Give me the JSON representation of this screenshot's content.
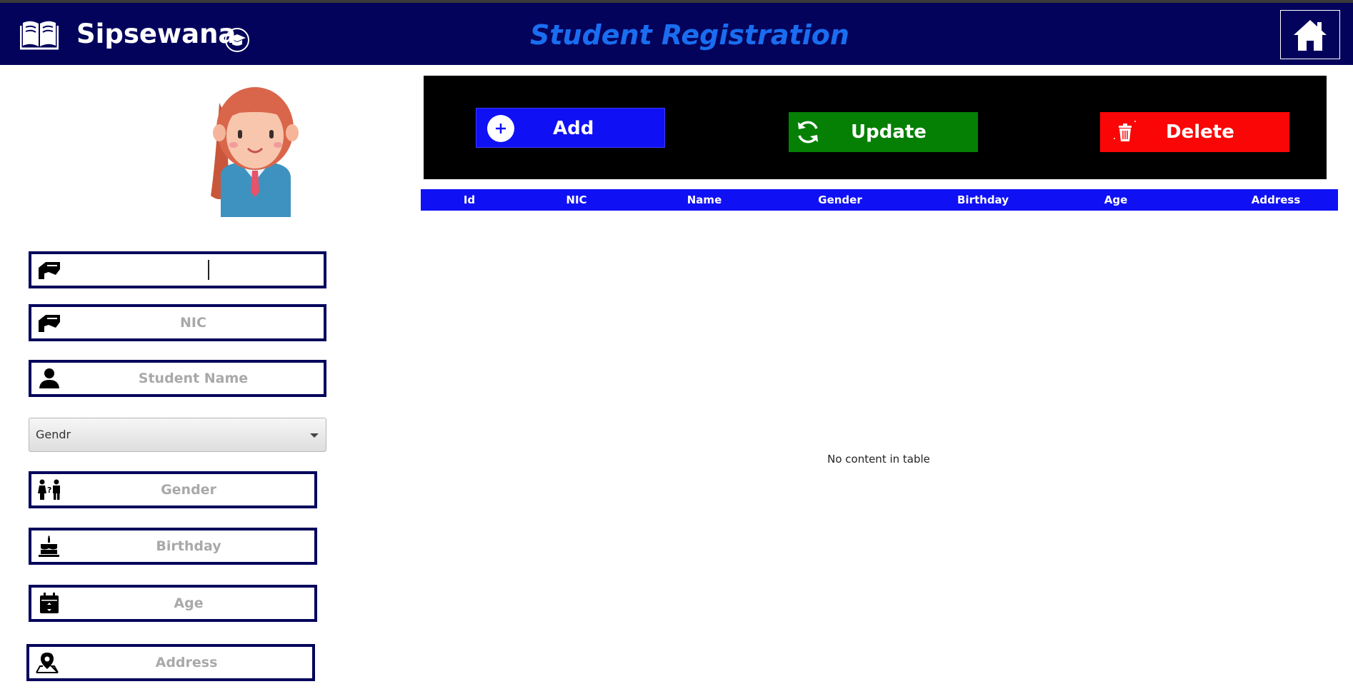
{
  "app": {
    "name": "Sipsewana",
    "page_title": "Student Registration"
  },
  "icons": {
    "logo": "open-book-icon",
    "logo_badge": "graduation-cap-icon",
    "home": "home-icon",
    "add": "plus-circle-icon",
    "update": "refresh-icon",
    "delete": "trash-icon"
  },
  "form": {
    "id_field": {
      "value": "",
      "placeholder": "",
      "icon": "id-card-icon"
    },
    "nic_field": {
      "value": "",
      "placeholder": "NIC",
      "icon": "id-card-icon"
    },
    "name_field": {
      "value": "",
      "placeholder": "Student Name",
      "icon": "person-icon"
    },
    "gender_select": {
      "selected": "Gendr"
    },
    "gender_field": {
      "value": "",
      "placeholder": "Gender",
      "icon": "gender-icon"
    },
    "birthday_field": {
      "value": "",
      "placeholder": "Birthday",
      "icon": "cake-icon"
    },
    "age_field": {
      "value": "",
      "placeholder": "Age",
      "icon": "calendar-icon"
    },
    "address_field": {
      "value": "",
      "placeholder": "Address",
      "icon": "map-pin-icon"
    }
  },
  "toolbar": {
    "add_label": "Add",
    "update_label": "Update",
    "delete_label": "Delete"
  },
  "table": {
    "columns": [
      "Id",
      "NIC",
      "Name",
      "Gender",
      "Birthday",
      "Age",
      "Address"
    ],
    "rows": [],
    "empty_message": "No content in table"
  },
  "colors": {
    "header_bg": "#03035c",
    "title": "#1a6df0",
    "add": "#1010f5",
    "update": "#058005",
    "delete": "#fb0606",
    "table_header": "#1010f5"
  }
}
